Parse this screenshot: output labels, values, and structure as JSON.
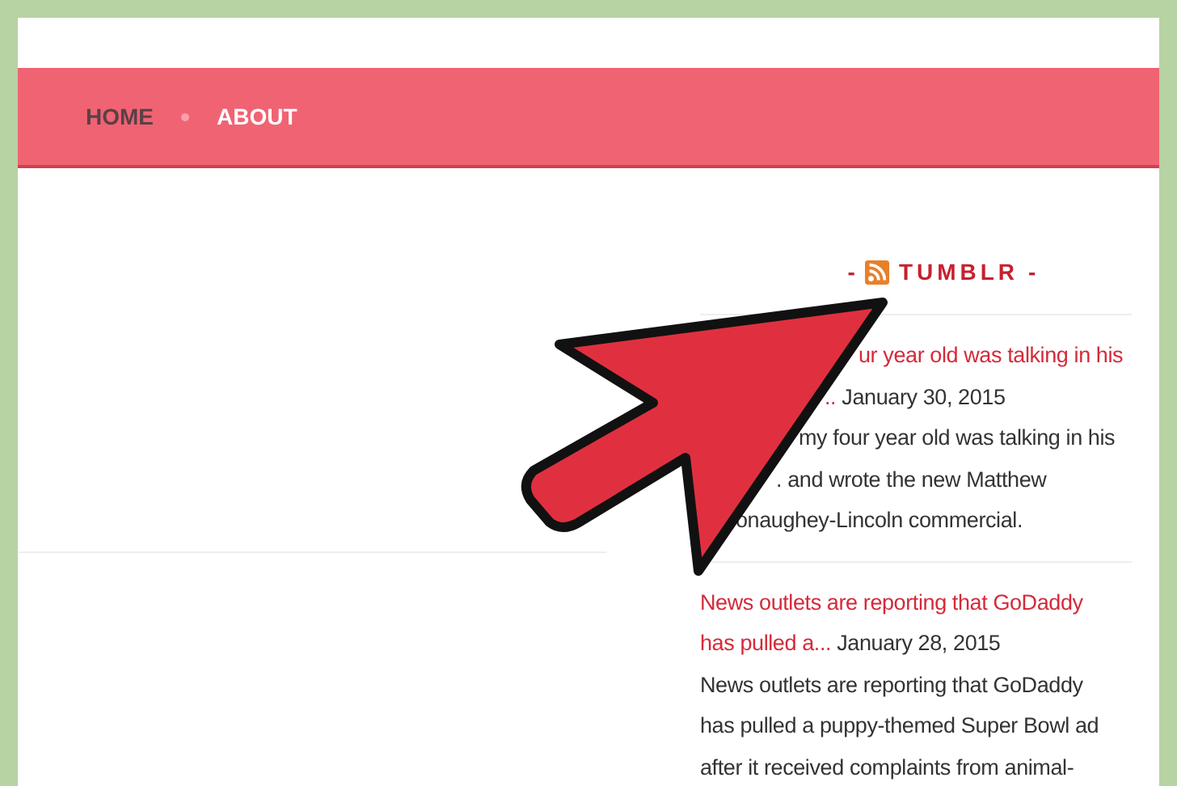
{
  "nav": {
    "items": [
      {
        "label": "HOME",
        "selected": false
      },
      {
        "label": "ABOUT",
        "selected": true
      }
    ]
  },
  "sidebar": {
    "widget_title": {
      "before": "-",
      "title": "TUMBLR",
      "after": "-"
    },
    "posts": [
      {
        "title_lines": [
          "ur year old was talking in his",
          ".."
        ],
        "date": "January 30, 2015",
        "excerpt_lines": [
          "my four year old was talking in his",
          ". and wrote the new Matthew",
          "onaughey-Lincoln commercial."
        ]
      },
      {
        "title_lines": [
          "News outlets are reporting that GoDaddy",
          "has pulled a..."
        ],
        "date": "January 28, 2015",
        "excerpt_lines": [
          "News outlets are reporting that GoDaddy",
          "has pulled a puppy-themed Super Bowl ad",
          "after it received complaints from animal-"
        ]
      }
    ]
  }
}
